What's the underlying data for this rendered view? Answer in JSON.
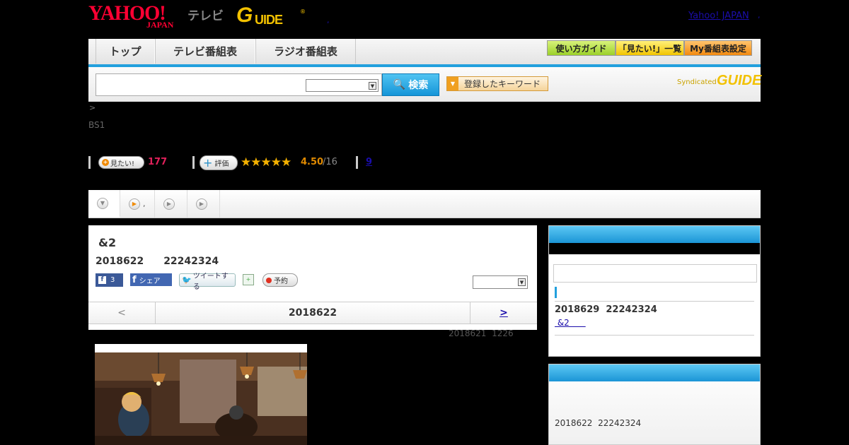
{
  "header": {
    "yahoo_logo": "YAHOO!",
    "yahoo_japan_sub": "JAPAN",
    "tv_logo": "テレビ",
    "gguide_logo_g": "G",
    "gguide_logo_rest": "UIDE",
    "gguide_reg": "®",
    "yahoo_japan_link": "Yahoo! JAPAN",
    "dot_1": ",",
    "dot_2": ","
  },
  "nav": {
    "top": "トップ",
    "tv": "テレビ番組表",
    "radio": "ラジオ番組表",
    "guide": "使い方ガイド",
    "mitai_list": "「見たい!」一覧",
    "my_schedule": "My番組表設定"
  },
  "search": {
    "button": "検索",
    "keyword_button": "登録したキーワード",
    "syndicated": "Syndicated",
    "syndicated_logo": "GUIDE"
  },
  "breadcrumb": ">",
  "channel": "BS1",
  "stats": {
    "mitai_label": "見たい!",
    "mitai_count": "177",
    "rate_label": "評価",
    "stars": "★★★★★",
    "rating": "4.50",
    "rating_count": "/16",
    "review_link": "9"
  },
  "tabs": {
    "tab2_suffix": ","
  },
  "program": {
    "title": "&2",
    "datetime": "2018622　　22242324",
    "fb_like_count": "3",
    "fb_share": "シェア",
    "tweet": "ツイートする",
    "yoyaku": "予約",
    "date_prev": "<",
    "date_current": "2018622",
    "date_next": ">",
    "update_info": "2018621  1226"
  },
  "side": {
    "next_datetime": "2018629  22242324",
    "next_title": " &2      ",
    "panel2_datetime": "2018622  22242324"
  }
}
